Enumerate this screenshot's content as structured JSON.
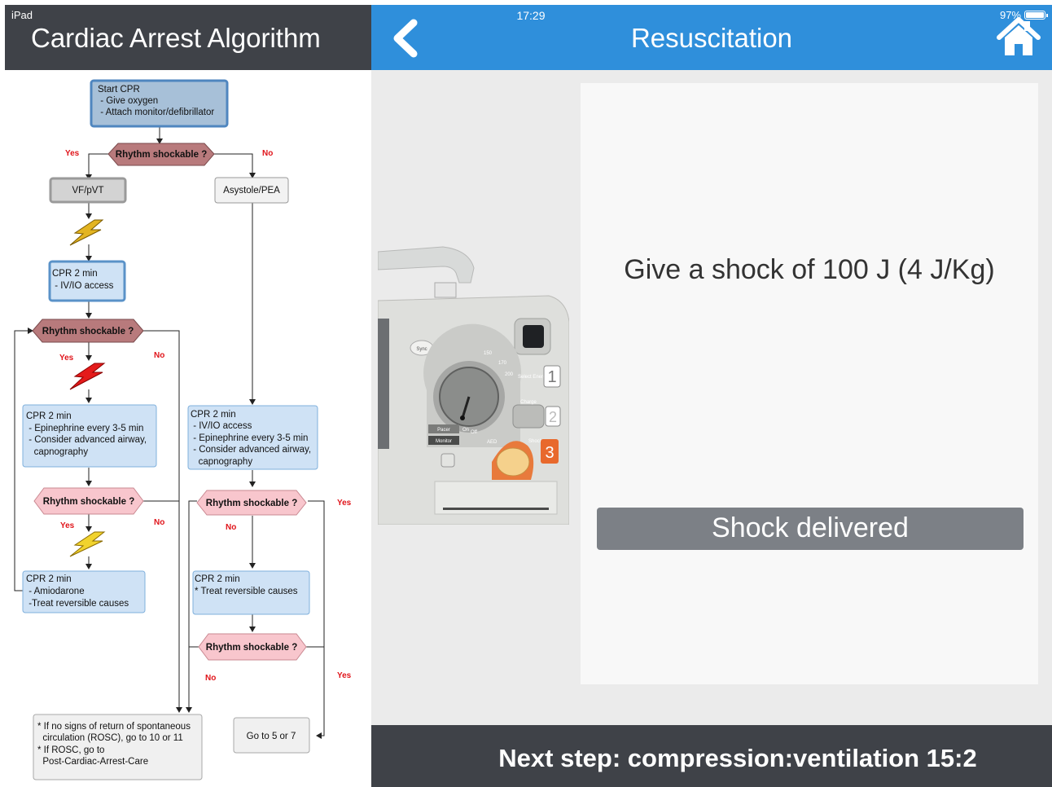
{
  "status_bar": {
    "device": "iPad",
    "time": "17:29",
    "battery": "97%"
  },
  "left": {
    "title": "Cardiac Arrest Algorithm",
    "flowchart": {
      "start": [
        "Start CPR",
        " - Give oxygen",
        " - Attach monitor/defibrillator"
      ],
      "decision1": "Rhythm shockable ?",
      "yes": "Yes",
      "no": "No",
      "vf": "VF/pVT",
      "asystole": "Asystole/PEA",
      "cpr_a": [
        "CPR 2 min",
        " - IV/IO access"
      ],
      "decision2": "Rhythm shockable ?",
      "cpr_b": [
        "CPR 2 min",
        " - Epinephrine every 3-5 min",
        " - Consider advanced airway,",
        "   capnography"
      ],
      "cpr_c": [
        "CPR 2 min",
        " - IV/IO access",
        " - Epinephrine every 3-5 min",
        " - Consider advanced airway,",
        "   capnography"
      ],
      "decision3": "Rhythm shockable ?",
      "decision4": "Rhythm shockable ?",
      "cpr_d": [
        "CPR 2 min",
        " - Amiodarone",
        " -Treat reversible causes"
      ],
      "cpr_e": [
        "CPR 2 min",
        "* Treat reversible causes"
      ],
      "decision5": "Rhythm shockable ?",
      "final": [
        "* If no signs of return of spontaneous",
        "  circulation (ROSC), go to 10 or 11",
        "* If ROSC, go to",
        "  Post-Cardiac-Arrest-Care"
      ],
      "goto": "Go to 5 or 7"
    }
  },
  "right": {
    "title": "Resuscitation",
    "instruction": "Give a shock of 100 J (4 J/Kg)",
    "shock_button": "Shock delivered",
    "next_step": "Next step: compression:ventilation 15:2",
    "defibrillator_labels": {
      "sync": "Sync",
      "energy": [
        "150",
        "170",
        "200"
      ],
      "select_energy": "Select Energy",
      "charge": "Charge",
      "shock": "Shock",
      "pacer": "Pacer",
      "off": "Off",
      "on": "On",
      "monitor": "Monitor",
      "aed": "AED",
      "step1": "1",
      "step2": "2",
      "step3": "3"
    }
  },
  "colors": {
    "header_dark": "#3f4248",
    "header_blue": "#2f8fdb",
    "button_gray": "#7c8086",
    "decision_dark": "#b87a7c",
    "decision_light": "#f8c6cd",
    "step_blue": "#cfe2f5",
    "step_blue_border": "#5a92c8"
  }
}
